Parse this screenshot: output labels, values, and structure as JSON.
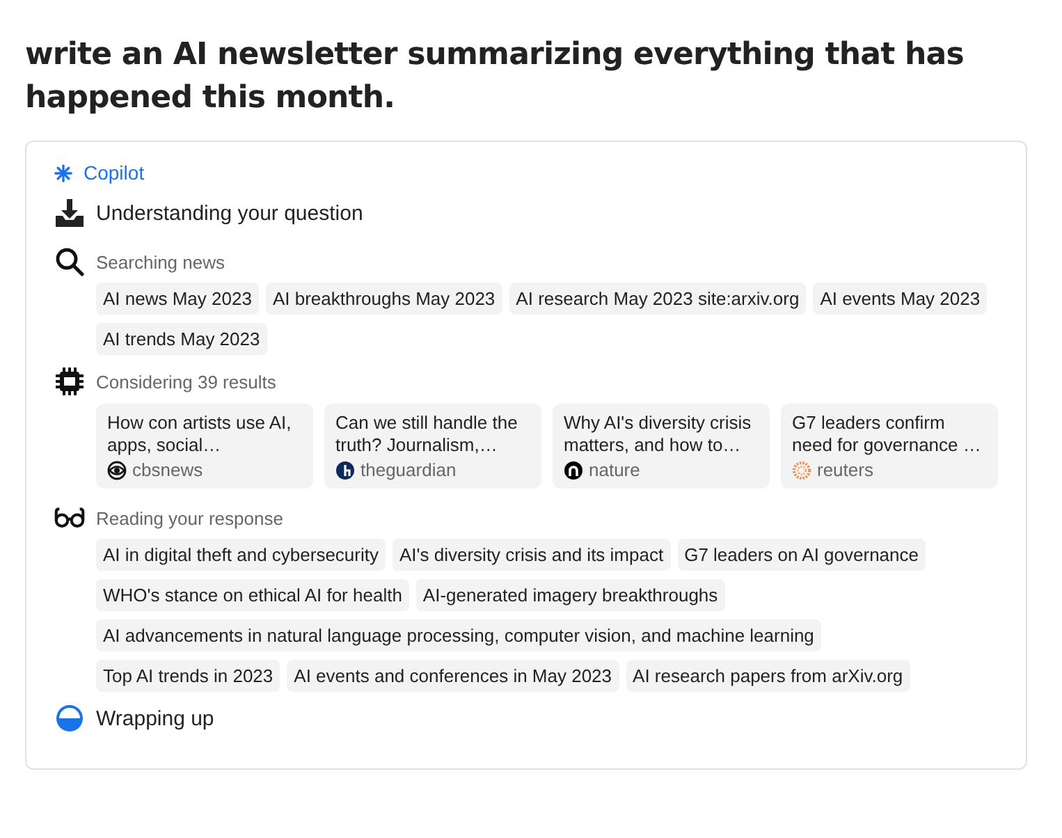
{
  "prompt": "write an AI newsletter summarizing everything that has happened this month.",
  "assistant": "Copilot",
  "steps": [
    {
      "kind": "main",
      "label": "Understanding your question"
    },
    {
      "kind": "chips",
      "label": "Searching news",
      "rows": [
        [
          "AI news May 2023",
          "AI breakthroughs May 2023",
          "AI research May 2023 site:arxiv.org",
          "AI events May 2023"
        ],
        [
          "AI trends May 2023"
        ]
      ]
    },
    {
      "kind": "results",
      "label": "Considering 39 results",
      "results": [
        {
          "title": "How con artists use AI, apps, social…",
          "source": "cbsnews"
        },
        {
          "title": "Can we still handle the truth? Journalism,…",
          "source": "theguardian"
        },
        {
          "title": "Why AI's diversity crisis matters, and how to…",
          "source": "nature"
        },
        {
          "title": "G7 leaders confirm need for governance …",
          "source": "reuters"
        }
      ]
    },
    {
      "kind": "chips",
      "label": "Reading your response",
      "rows": [
        [
          "AI in digital theft and cybersecurity",
          "AI's diversity crisis and its impact",
          "G7 leaders on AI governance"
        ],
        [
          "WHO's stance on ethical AI for health",
          "AI-generated imagery breakthroughs"
        ],
        [
          "AI advancements in natural language processing, computer vision, and machine learning"
        ],
        [
          "Top AI trends in 2023",
          "AI events and conferences in May 2023",
          "AI research papers from arXiv.org"
        ]
      ]
    },
    {
      "kind": "main",
      "label": "Wrapping up"
    }
  ]
}
